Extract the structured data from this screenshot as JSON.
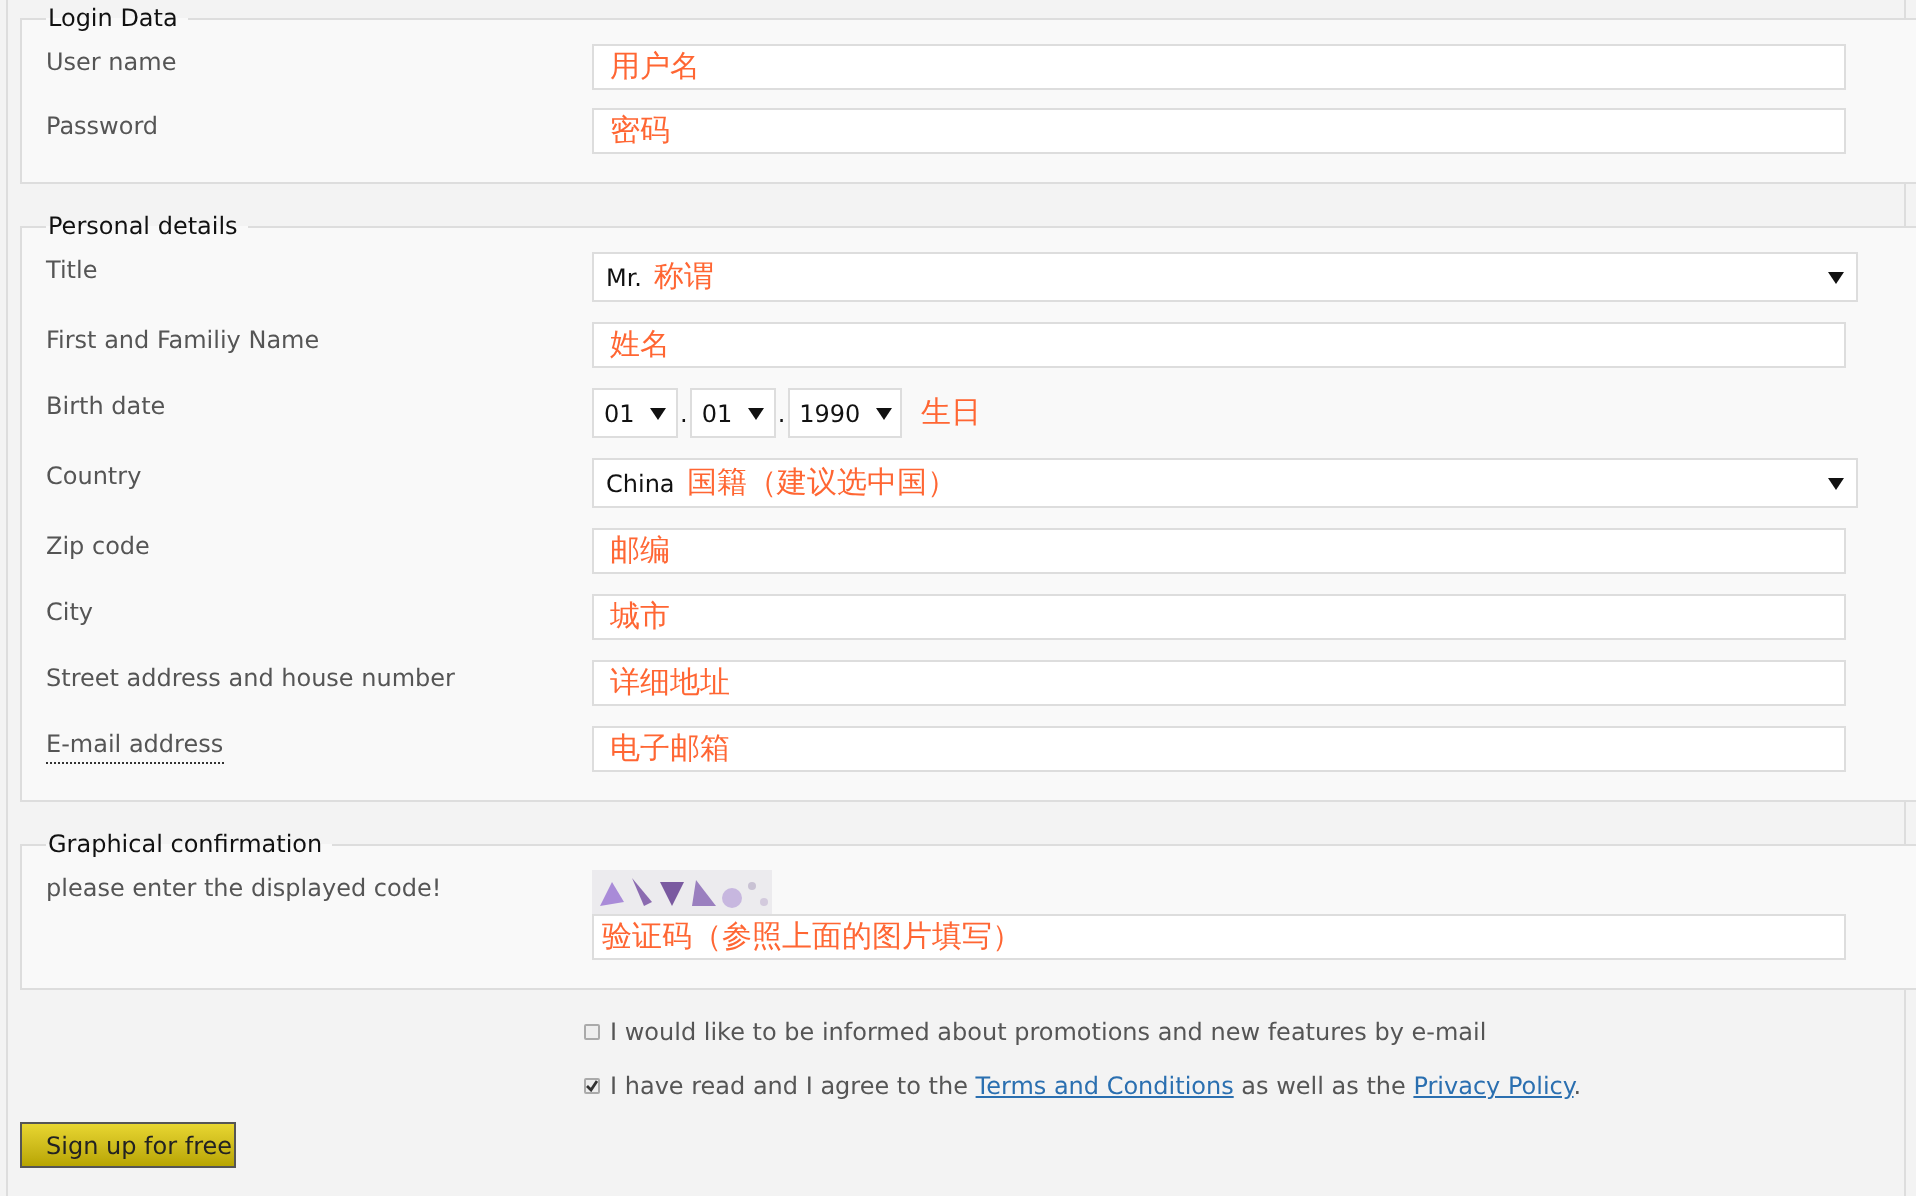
{
  "sections": [
    {
      "title": "Login Data",
      "rows": [
        {
          "kind": "text",
          "label": "User name",
          "value": "用户名"
        },
        {
          "kind": "text",
          "label": "Password",
          "value": "密码"
        }
      ]
    },
    {
      "title": "Personal details",
      "rows": [
        {
          "kind": "select",
          "label": "Title",
          "value": "Mr.",
          "note": "称谓"
        },
        {
          "kind": "text",
          "label": "First and Familiy Name",
          "value": "姓名"
        },
        {
          "kind": "date",
          "label": "Birth date",
          "parts": [
            "01",
            "01",
            "1990"
          ],
          "separator": ".",
          "note": "生日"
        },
        {
          "kind": "select",
          "label": "Country",
          "value": "China",
          "note": "国籍（建议选中国）"
        },
        {
          "kind": "text",
          "label": "Zip code",
          "value": "邮编"
        },
        {
          "kind": "text",
          "label": "City",
          "value": "城市"
        },
        {
          "kind": "text",
          "label": "Street address and house number",
          "value": "详细地址"
        },
        {
          "kind": "text",
          "label": "E-mail address",
          "value": "电子邮箱",
          "dotted": true
        }
      ]
    },
    {
      "title": "Graphical confirmation",
      "rows": [
        {
          "kind": "captcha",
          "label": "please enter the displayed code!",
          "value": "验证码（参照上面的图片填写）"
        }
      ]
    }
  ],
  "options": [
    {
      "checked": false,
      "text": "I would like to be informed about promotions and new features by e-mail"
    },
    {
      "checked": true,
      "text": "I have read and I agree to the ",
      "link": "Terms and Conditions",
      "middle": " as well as the ",
      "link2": "Privacy Policy",
      "after": "."
    }
  ],
  "submit": "Sign up for free"
}
